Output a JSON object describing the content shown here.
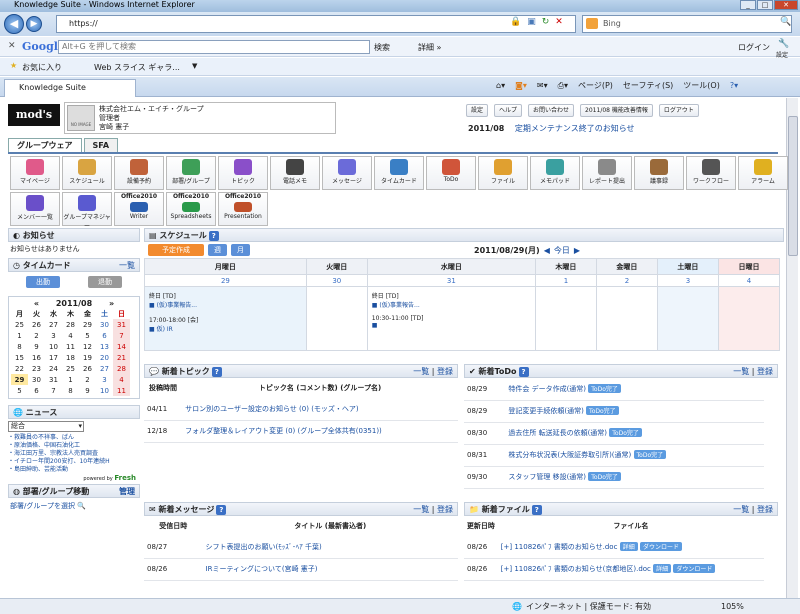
{
  "browser": {
    "title": "Knowledge Suite - Windows Internet Explorer",
    "url": "https://",
    "search_engine": "Bing",
    "google_label": "Google",
    "google_placeholder": "Alt+G を押して検索",
    "google_search_btn": "検索",
    "google_more": "詳細 »",
    "login": "ログイン",
    "settings": "設定",
    "favorites": "お気に入り",
    "web_slices": "Web スライス ギャラ...",
    "tab_title": "Knowledge Suite",
    "cmd_page": "ページ(P)",
    "cmd_safety": "セーフティ(S)",
    "cmd_tools": "ツール(O)",
    "status_zone": "インターネット | 保護モード: 有効",
    "zoom": "105%"
  },
  "header": {
    "logo": "mod's hair",
    "no_image": "NO IMAGE",
    "company": "株式会社エム・エイチ・グループ",
    "role": "管理者",
    "user": "宮崎 憲子",
    "btn_settings": "設定",
    "btn_help": "ヘルプ",
    "btn_contact": "お問い合わせ",
    "btn_info": "2011/08 機能改善情報",
    "btn_logout": "ログアウト",
    "notice_date": "2011/08",
    "notice_text": "定期メンテナンス終了のお知らせ"
  },
  "main_tabs": [
    "グループウェア",
    "SFA"
  ],
  "apps": [
    {
      "label": "マイページ",
      "color": "#e05a8a"
    },
    {
      "label": "スケジュール",
      "color": "#d9a441"
    },
    {
      "label": "設備予約",
      "color": "#c0623a"
    },
    {
      "label": "部署/グループ",
      "color": "#3e9f58"
    },
    {
      "label": "トピック",
      "color": "#8a4fc9"
    },
    {
      "label": "電話メモ",
      "color": "#444444"
    },
    {
      "label": "メッセージ",
      "color": "#6b6bd9"
    },
    {
      "label": "タイムカード",
      "color": "#3a7fc5"
    },
    {
      "label": "ToDo",
      "color": "#d0553a"
    },
    {
      "label": "ファイル",
      "color": "#e0a030"
    },
    {
      "label": "メモパッド",
      "color": "#3aa0a0"
    },
    {
      "label": "レポート提出",
      "color": "#8a8a8a"
    },
    {
      "label": "議事録",
      "color": "#9a6a3a"
    },
    {
      "label": "ワークフロー",
      "color": "#555555"
    },
    {
      "label": "アラーム",
      "color": "#e0b020"
    },
    {
      "label": "メンバー一覧",
      "color": "#6a4fc9"
    },
    {
      "label": "グループマネジャー",
      "color": "#5a5ad0"
    },
    {
      "label": "Writer",
      "color": "#2a5fb0"
    },
    {
      "label": "Spreadsheets",
      "color": "#2a9a4a"
    },
    {
      "label": "Presentation",
      "color": "#c0502a"
    }
  ],
  "office_label": "Office2010",
  "sidebar": {
    "notice_title": "お知らせ",
    "notice_text": "お知らせはありません",
    "timecard_title": "タイムカード",
    "timecard_list": "一覧",
    "clock_in": "出勤",
    "clock_out": "退勤",
    "cal_month": "2011/08",
    "cal_head": [
      "月",
      "火",
      "水",
      "木",
      "金",
      "土",
      "日"
    ],
    "cal_rows": [
      [
        "25",
        "26",
        "27",
        "28",
        "29",
        "30",
        "31"
      ],
      [
        "1",
        "2",
        "3",
        "4",
        "5",
        "6",
        "7"
      ],
      [
        "8",
        "9",
        "10",
        "11",
        "12",
        "13",
        "14"
      ],
      [
        "15",
        "16",
        "17",
        "18",
        "19",
        "20",
        "21"
      ],
      [
        "22",
        "23",
        "24",
        "25",
        "26",
        "27",
        "28"
      ],
      [
        "29",
        "30",
        "31",
        "1",
        "2",
        "3",
        "4"
      ],
      [
        "5",
        "6",
        "7",
        "8",
        "9",
        "10",
        "11"
      ]
    ],
    "news_title": "ニュース",
    "news_select": "総合",
    "news_items": [
      "・救難員の不祥事、ばん",
      "・原油価格、中国石油化工",
      "・海江田万里、宗教法人売買調査",
      "・イチロー年間200安打、10年連続H",
      "・島田紳助、芸能活動"
    ],
    "powered": "powered by",
    "powered_brand": "Fresh",
    "dept_title": "部署/グループ移動",
    "dept_manage": "管理",
    "dept_link": "部署/グループを選択"
  },
  "schedule": {
    "title": "スケジュール",
    "btn_plan": "予定作成",
    "btn_week": "週",
    "btn_month": "月",
    "date_label": "2011/08/29(月)",
    "today": "今日",
    "days": [
      "月曜日",
      "火曜日",
      "水曜日",
      "木曜日",
      "金曜日",
      "土曜日",
      "日曜日"
    ],
    "dates": [
      "29",
      "30",
      "31",
      "1",
      "2",
      "3",
      "4"
    ],
    "events": [
      {
        "day": 0,
        "lines": [
          "終日 [TD]",
          "■ (仮)事業報告...",
          "17:00-18:00 [会]",
          "■ 仮) IR"
        ]
      },
      {
        "day": 2,
        "lines": [
          "終日 [TD]",
          "■ (仮)事業報告...",
          "10:30-11:00 [TD]",
          "■"
        ]
      }
    ]
  },
  "topics": {
    "title": "新着トピック",
    "list": "一覧",
    "register": "登録",
    "col_time": "投稿時間",
    "col_topic": "トピック名 (コメント数) (グループ名)",
    "rows": [
      {
        "date": "04/11",
        "text": "サロン別のユーザー設定のお知らせ (0) (モッズ・ヘア)"
      },
      {
        "date": "12/18",
        "text": "フォルダ整理＆レイアウト変更 (0) (グループ全体共有(0351))"
      }
    ]
  },
  "todo": {
    "title": "新着ToDo",
    "list": "一覧",
    "register": "登録",
    "badge": "ToDo完了",
    "rows": [
      {
        "date": "08/29",
        "text": "特件会 データ作成(通常)"
      },
      {
        "date": "08/29",
        "text": "登記変更手続依頼(通常)"
      },
      {
        "date": "08/30",
        "text": "過去住所 転送延長の依頼(通常)"
      },
      {
        "date": "08/31",
        "text": "株式分布状況表(大阪証券取引所)(通常)"
      },
      {
        "date": "09/30",
        "text": "スタッフ管理 移設(通常)"
      }
    ]
  },
  "messages": {
    "title": "新着メッセージ",
    "list": "一覧",
    "register": "登録",
    "col_date": "受信日時",
    "col_title": "タイトル (最新書込者)",
    "rows": [
      {
        "date": "08/27",
        "text": "シフト表提出のお願い(ﾓｯｽﾞ･ﾍｱ 千葉)"
      },
      {
        "date": "08/26",
        "text": "IRミーティングについて(宮崎 憲子)"
      }
    ]
  },
  "files": {
    "title": "新着ファイル",
    "list": "一覧",
    "register": "登録",
    "col_date": "更新日時",
    "col_name": "ファイル名",
    "detail": "詳細",
    "download": "ダウンロード",
    "rows": [
      {
        "date": "08/26",
        "text": "[+] 110826ﾊﾟﾌ 書類のお知らせ.doc"
      },
      {
        "date": "08/26",
        "text": "[+] 110826ﾊﾟﾌ 書類のお知らせ(京都地区).doc"
      }
    ]
  }
}
